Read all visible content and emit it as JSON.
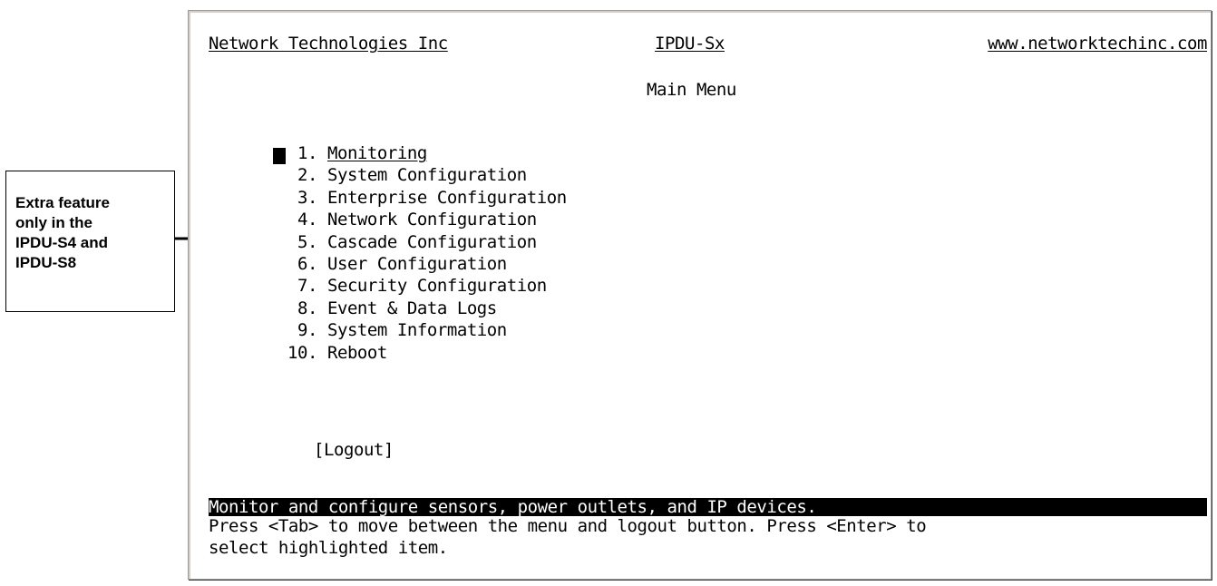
{
  "callout": {
    "lines": [
      "Extra feature",
      "only in the",
      "IPDU-S4 and",
      "IPDU-S8"
    ]
  },
  "terminal": {
    "header": {
      "company": "Network Technologies Inc",
      "product": "IPDU-Sx",
      "website": "www.networktechinc.com"
    },
    "title": "Main Menu",
    "menu": {
      "selected_index": 0,
      "items": [
        {
          "number": " 1.",
          "label": "Monitoring"
        },
        {
          "number": " 2.",
          "label": "System Configuration"
        },
        {
          "number": " 3.",
          "label": "Enterprise Configuration"
        },
        {
          "number": " 4.",
          "label": "Network Configuration"
        },
        {
          "number": " 5.",
          "label": "Cascade Configuration"
        },
        {
          "number": " 6.",
          "label": "User Configuration"
        },
        {
          "number": " 7.",
          "label": "Security Configuration"
        },
        {
          "number": " 8.",
          "label": "Event & Data Logs"
        },
        {
          "number": " 9.",
          "label": "System Information"
        },
        {
          "number": "10.",
          "label": "Reboot"
        }
      ]
    },
    "logout_button": "[Logout]",
    "status_text": "Monitor and configure sensors, power outlets, and IP devices.",
    "help_line_1": "Press <Tab> to move between the menu and logout button. Press <Enter> to",
    "help_line_2": "select highlighted item."
  }
}
